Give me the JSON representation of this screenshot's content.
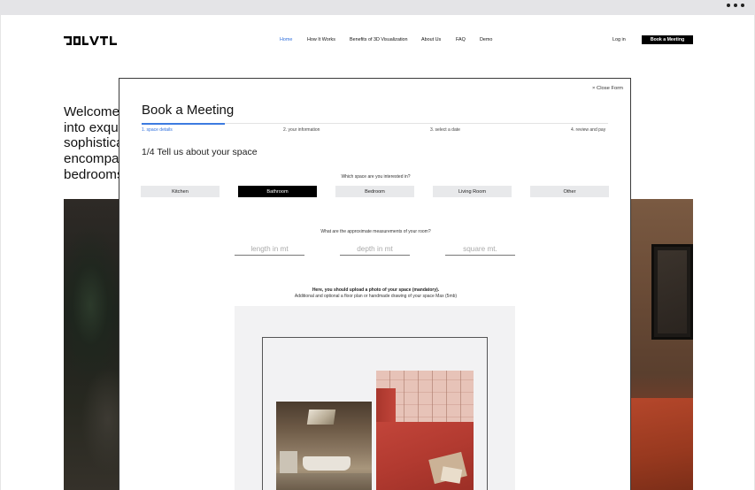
{
  "browser": {
    "menu_icon": "more-dots-icon"
  },
  "header": {
    "logo_text": "LOLVTL",
    "nav": [
      {
        "label": "Home",
        "active": true
      },
      {
        "label": "How It Works",
        "active": false
      },
      {
        "label": "Benefits of 3D Visualization",
        "active": false
      },
      {
        "label": "About Us",
        "active": false
      },
      {
        "label": "FAQ",
        "active": false
      },
      {
        "label": "Demo",
        "active": false
      }
    ],
    "login_label": "Log in",
    "book_label": "Book a Meeting",
    "accent_color": "#2f6fdc"
  },
  "hero": {
    "lines": [
      "Welcome",
      "into exqu",
      "sophistica",
      "encompa",
      "bedrooms"
    ]
  },
  "modal": {
    "close_label": "× Close Form",
    "title": "Book a Meeting",
    "steps": [
      {
        "label": "1. space details",
        "active": true
      },
      {
        "label": "2. your information",
        "active": false
      },
      {
        "label": "3. select a date",
        "active": false
      },
      {
        "label": "4. review and pay",
        "active": false
      }
    ],
    "progress_fraction": 0.18,
    "section_title": "1/4 Tell us about your space",
    "space_question": "Which space are you interested in?",
    "space_options": [
      {
        "label": "Kitchen",
        "selected": false
      },
      {
        "label": "Bathroom",
        "selected": true
      },
      {
        "label": "Bedroom",
        "selected": false
      },
      {
        "label": "Living Room",
        "selected": false
      },
      {
        "label": "Other",
        "selected": false
      }
    ],
    "measure_question": "What are the approximate measurements of your room?",
    "measurements": [
      {
        "placeholder": "length in mt",
        "value": ""
      },
      {
        "placeholder": "depth in mt",
        "value": ""
      },
      {
        "placeholder": "square mt.",
        "value": ""
      }
    ],
    "upload_title": "Here, you should upload a photo of your space (mandatory).",
    "upload_subtitle": "Additional and optional a floor plan or handmade drawing of your space Max (5mb)"
  }
}
